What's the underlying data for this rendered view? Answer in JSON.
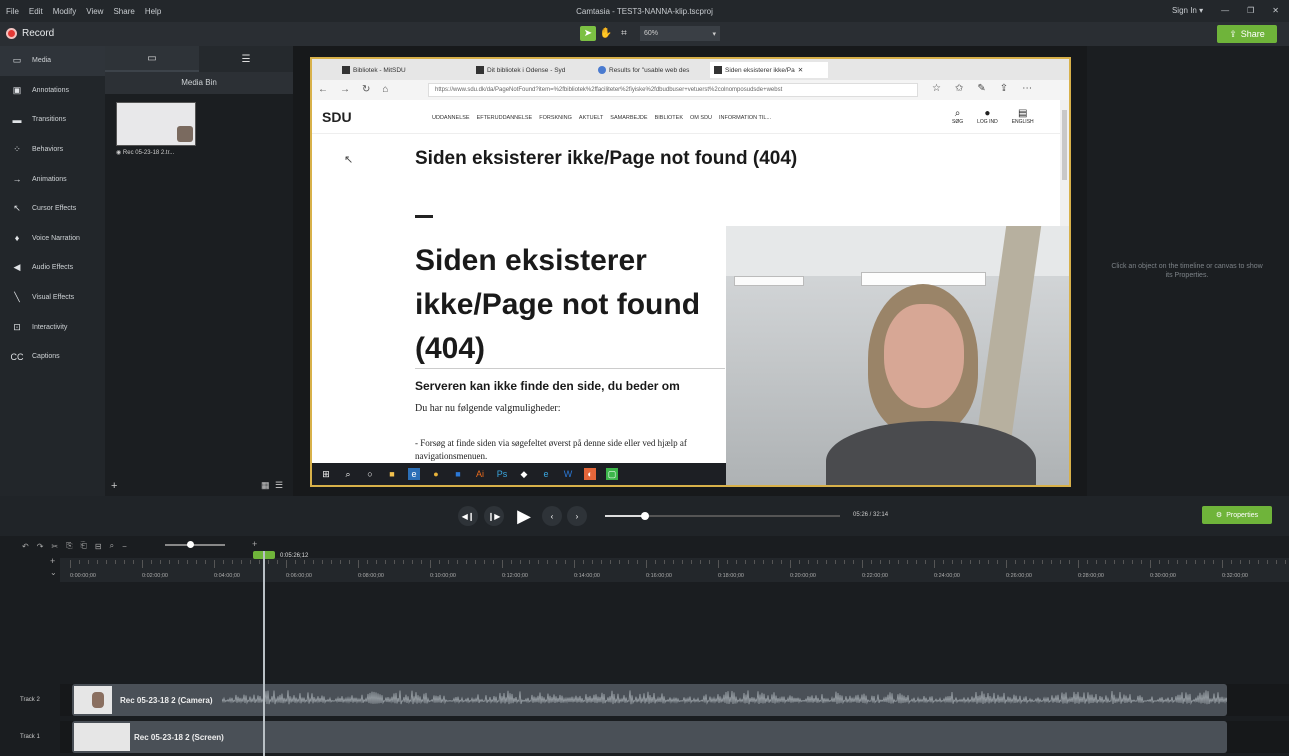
{
  "window": {
    "title": "Camtasia - TEST3-NANNA-klip.tscproj",
    "menu": [
      "File",
      "Edit",
      "Modify",
      "View",
      "Share",
      "Help"
    ],
    "sign_in": "Sign In ▾"
  },
  "toolbar": {
    "record_label": "Record",
    "zoom_value": "60%",
    "share_label": "Share"
  },
  "sidebar": {
    "items": [
      {
        "label": "Media",
        "icon": "film-icon"
      },
      {
        "label": "Annotations",
        "icon": "annotation-icon"
      },
      {
        "label": "Transitions",
        "icon": "transition-icon"
      },
      {
        "label": "Behaviors",
        "icon": "behavior-icon"
      },
      {
        "label": "Animations",
        "icon": "animation-icon"
      },
      {
        "label": "Cursor Effects",
        "icon": "cursor-icon"
      },
      {
        "label": "Voice Narration",
        "icon": "microphone-icon"
      },
      {
        "label": "Audio Effects",
        "icon": "speaker-icon"
      },
      {
        "label": "Visual Effects",
        "icon": "wand-icon"
      },
      {
        "label": "Interactivity",
        "icon": "interactivity-icon"
      },
      {
        "label": "Captions",
        "icon": "cc-icon"
      }
    ]
  },
  "media_bin": {
    "title": "Media Bin",
    "item_caption": "◉ Rec 05-23-18 2.tr..."
  },
  "browser": {
    "tabs": [
      "Bibliotek - MitSDU",
      "Dit bibliotek i Odense - Syd",
      "Results for \"usable web des",
      "Siden eksisterer ikke/Pa"
    ],
    "url": "https://www.sdu.dk/da/PageNotFound?item=%2fbibliotek%2ffaciliteter%2fiyiske%2fdbudbuser+vetuerst%2colnomposudsde+webst",
    "sdu_logo": "SDU",
    "nav_links": [
      "UDDANNELSE",
      "EFTERUDDANNELSE",
      "FORSKNING",
      "AKTUELT",
      "SAMARBEJDE",
      "BIBLIOTEK",
      "OM SDU",
      "INFORMATION TIL..."
    ],
    "nav_right": [
      "SØG",
      "LOG IND",
      "ENGLISH"
    ],
    "heading_small": "Siden eksisterer ikke/Page not found (404)",
    "heading_big": "Siden eksisterer ikke/Page not found (404)",
    "subheading": "Serveren kan ikke finde den side, du beder om",
    "para1": "Du har nu følgende valgmuligheder:",
    "para2": "- Forsøg at finde siden via søgefeltet øverst på denne side eller ved hjælp af navigationsmenuen."
  },
  "properties": {
    "hint": "Click an object on the timeline or canvas to show its Properties.",
    "button_label": "Properties"
  },
  "playback": {
    "timecode": "05:26 / 32:14",
    "progress": 0.169
  },
  "timeline": {
    "playhead_label": "0:05:26;12",
    "ticks": [
      "0:00:00;00",
      "0:02:00;00",
      "0:04:00;00",
      "0:06:00;00",
      "0:08:00;00",
      "0:10:00;00",
      "0:12:00;00",
      "0:14:00;00",
      "0:16:00;00",
      "0:18:00;00",
      "0:20:00;00",
      "0:22:00;00",
      "0:24:00;00",
      "0:26:00;00",
      "0:28:00;00",
      "0:30:00;00",
      "0:32:00;00"
    ],
    "tracks": [
      {
        "label": "Track 2",
        "clip": "Rec 05-23-18 2 (Camera)"
      },
      {
        "label": "Track 1",
        "clip": "Rec 05-23-18 2 (Screen)"
      }
    ]
  },
  "colors": {
    "accent": "#6fb43a",
    "record": "#e53935"
  }
}
